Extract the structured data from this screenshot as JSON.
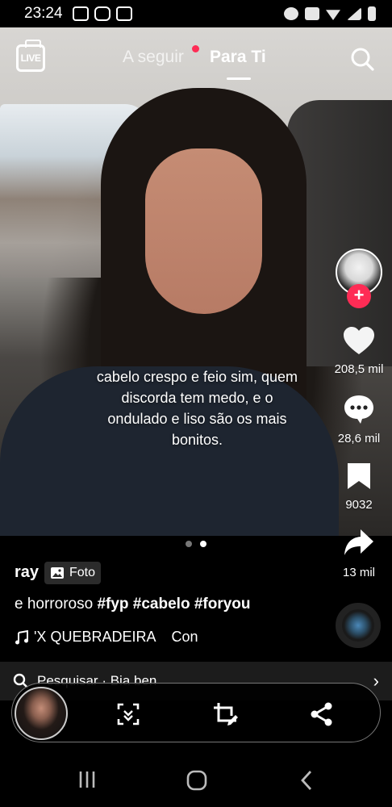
{
  "status_bar": {
    "time": "23:24"
  },
  "top_nav": {
    "live_label": "LIVE",
    "following_label": "A seguir",
    "for_you_label": "Para Ti"
  },
  "post": {
    "overlay_text": "cabelo crespo e feio sim, quem discorda tem medo, e o ondulado e liso são os mais bonitos.",
    "author": "ray",
    "badge_label": "Foto",
    "description_plain": "e horroroso ",
    "hashtags": "#fyp #cabelo #foryou",
    "music": "'X QUEBRADEIRA    Con"
  },
  "rail": {
    "likes": "208,5 mil",
    "comments": "28,6 mil",
    "saves": "9032",
    "shares": "13 mil"
  },
  "search_bar": {
    "text": "Pesquisar · Bia ben"
  },
  "colors": {
    "accent": "#fe2c55",
    "background": "#000000"
  },
  "icons": [
    "live-icon",
    "search-icon",
    "heart-icon",
    "comment-icon",
    "bookmark-icon",
    "share-arrow-icon",
    "music-note-icon",
    "photo-icon",
    "chevron-right-icon",
    "scan-icon",
    "crop-edit-icon",
    "share-icon",
    "recent-apps-icon",
    "home-icon",
    "back-icon"
  ]
}
